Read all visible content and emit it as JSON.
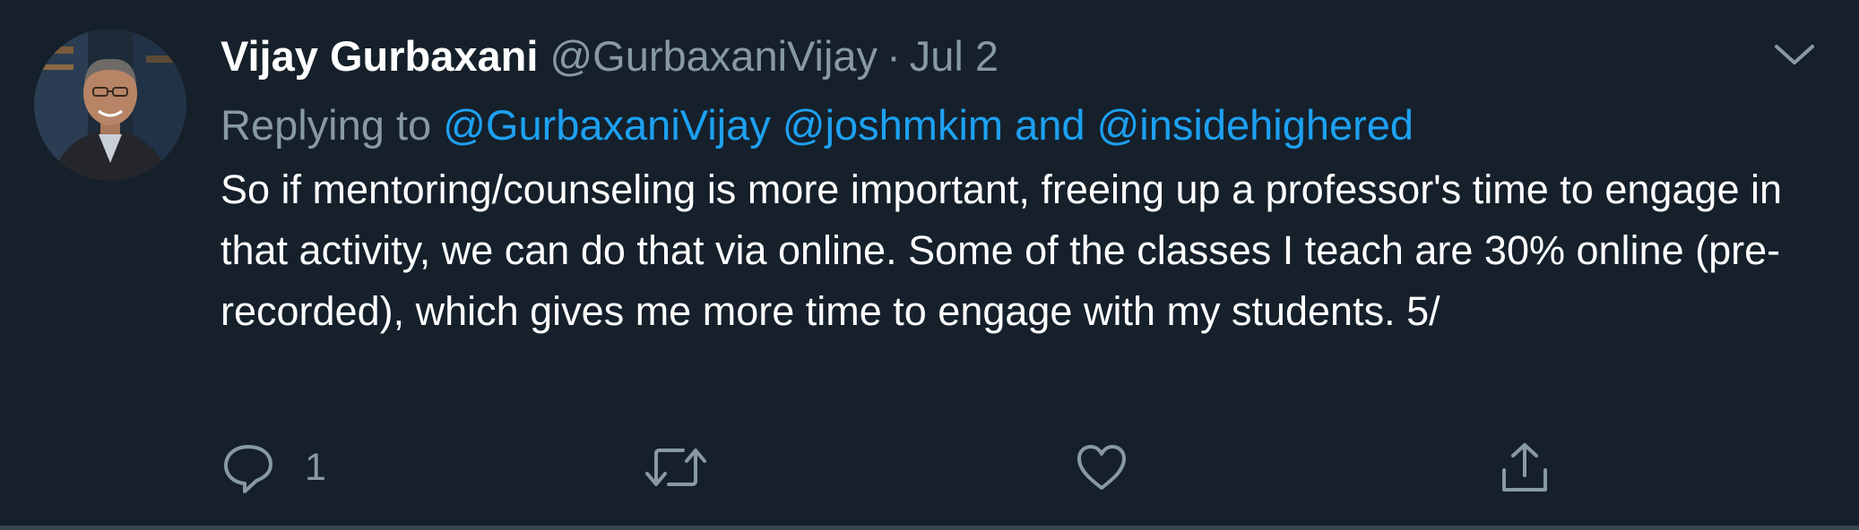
{
  "tweet": {
    "author": {
      "display_name": "Vijay Gurbaxani",
      "handle": "@GurbaxaniVijay"
    },
    "separator": "·",
    "date": "Jul 2",
    "replying_to": {
      "prefix": "Replying to",
      "mention_1": "@GurbaxaniVijay",
      "mention_2": "@joshmkim",
      "conjunction": "and",
      "mention_3": "@insidehighered"
    },
    "text": "So if mentoring/counseling is more important, freeing up a professor's time to engage in that activity, we can do that via online. Some of the classes I teach are 30% online (pre-recorded), which gives me more time to engage with my students. 5/"
  },
  "actions": {
    "reply_count": "1",
    "icons": [
      "reply-icon",
      "retweet-icon",
      "like-icon",
      "share-icon"
    ]
  },
  "icons": {
    "menu": "chevron-down-icon"
  },
  "colors": {
    "background": "#15202b",
    "text_primary": "#ffffff",
    "text_secondary": "#8899a6",
    "link": "#1da1f2",
    "divider": "#38444d"
  }
}
